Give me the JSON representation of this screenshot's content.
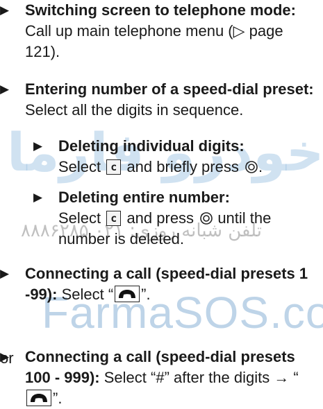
{
  "watermark": {
    "arabic": "امداد خودرو فارما",
    "phone": "تلفن شبانه روزی: ۰۲۱ ۸۸۸۶۲۸۵",
    "brand": "FarmaSOS.com"
  },
  "items": {
    "switching": {
      "bold": "Switching screen to telephone mode:",
      "text": "Call up main telephone menu (▷ page 121)."
    },
    "entering": {
      "bold": "Entering number of a speed-dial preset:",
      "text": "Select all the digits in sequence."
    },
    "deleting_digits": {
      "bold": "Deleting individual digits:",
      "pre": "Select",
      "key": "c",
      "post": "and briefly press",
      "end": "."
    },
    "deleting_number": {
      "bold": "Deleting entire number:",
      "pre": "Select",
      "key": "c",
      "post": "and press",
      "end": "until the number is deleted."
    },
    "connecting_1_99": {
      "bold": "Connecting a call (speed-dial presets 1 -99):",
      "pre": "Select “",
      "end": "”."
    },
    "or": "or",
    "connecting_100_999": {
      "bold": "Connecting a call (speed-dial presets 100 - 999):",
      "pre": "Select “#” after the digits → “",
      "end": "”."
    }
  },
  "icons": {
    "bullet": "triangle-bullet-icon",
    "knob": "rotary-knob-icon",
    "phone": "phone-handset-icon"
  }
}
